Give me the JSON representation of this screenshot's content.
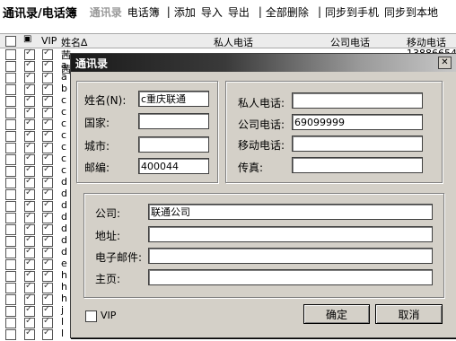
{
  "toolbar": {
    "title": "通讯录/电话簿",
    "tab_contacts": "通讯录",
    "tab_phonebook": "电话簿",
    "actions": [
      "添加",
      "导入",
      "导出",
      "全部删除",
      "同步到手机",
      "同步到本地"
    ],
    "separator": "|"
  },
  "list": {
    "headers": {
      "vip": "VIP",
      "name": "姓名∆",
      "home_phone": "私人电话",
      "company_phone": "公司电话",
      "mobile": "移动电话"
    },
    "rows": [
      {
        "name": "茜茜/",
        "mobile": "138866544"
      },
      {
        "name": "a"
      },
      {
        "name": "a"
      },
      {
        "name": "b"
      },
      {
        "name": "c"
      },
      {
        "name": "c"
      },
      {
        "name": "c"
      },
      {
        "name": "c"
      },
      {
        "name": "c"
      },
      {
        "name": "c"
      },
      {
        "name": "c"
      },
      {
        "name": "d"
      },
      {
        "name": "d"
      },
      {
        "name": "d"
      },
      {
        "name": "d"
      },
      {
        "name": "d"
      },
      {
        "name": "d"
      },
      {
        "name": "d"
      },
      {
        "name": "e"
      },
      {
        "name": "h"
      },
      {
        "name": "h"
      },
      {
        "name": "h"
      },
      {
        "name": "j"
      },
      {
        "name": "l"
      },
      {
        "name": "l"
      }
    ]
  },
  "dialog": {
    "title": "通讯录",
    "close_glyph": "✕",
    "labels": {
      "name": "姓名(N):",
      "country": "国家:",
      "city": "城市:",
      "zip": "邮编:",
      "home_phone": "私人电话:",
      "company_phone": "公司电话:",
      "mobile": "移动电话:",
      "fax": "传真:",
      "company": "公司:",
      "address": "地址:",
      "email": "电子邮件:",
      "homepage": "主页:",
      "vip": "VIP"
    },
    "values": {
      "name": "c重庆联通",
      "country": "",
      "city": "",
      "zip": "400044",
      "home_phone": "",
      "company_phone": "69099999",
      "mobile": "",
      "fax": "",
      "company": "联通公司",
      "address": "",
      "email": "",
      "homepage": ""
    },
    "vip_checked": false,
    "ok_label": "确定",
    "cancel_label": "取消"
  }
}
